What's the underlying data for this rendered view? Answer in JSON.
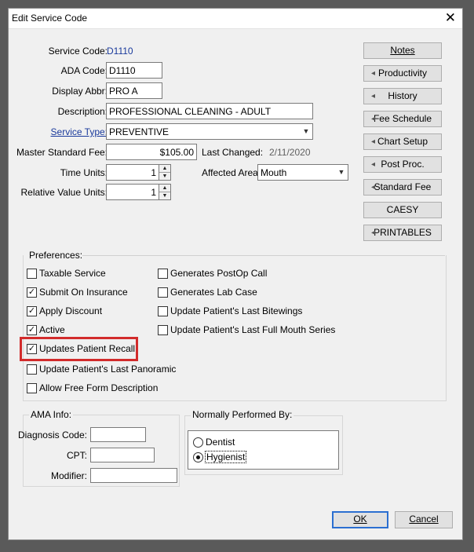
{
  "window": {
    "title": "Edit Service Code",
    "close_glyph": "✕"
  },
  "form": {
    "service_code_label": "Service Code:",
    "service_code_value": "D1110",
    "ada_code_label": "ADA Code:",
    "ada_code_value": "D1110",
    "display_abbr_label": "Display Abbr:",
    "display_abbr_value": "PRO A",
    "description_label": "Description:",
    "description_value": "PROFESSIONAL CLEANING - ADULT",
    "service_type_label": "Service Type:",
    "service_type_value": "PREVENTIVE",
    "master_fee_label": "Master Standard Fee:",
    "master_fee_value": "$105.00",
    "last_changed_label": "Last Changed:",
    "last_changed_value": "2/11/2020",
    "time_units_label": "Time Units:",
    "time_units_value": "1",
    "affected_area_label": "Affected Area:",
    "affected_area_value": "Mouth",
    "rvu_label": "Relative Value Units:",
    "rvu_value": "1"
  },
  "side_buttons": [
    {
      "label": "Notes"
    },
    {
      "label": "Productivity"
    },
    {
      "label": "History"
    },
    {
      "label": "Fee Schedule"
    },
    {
      "label": "Chart Setup"
    },
    {
      "label": "Post Proc."
    },
    {
      "label": "Standard Fee"
    },
    {
      "label": "CAESY"
    },
    {
      "label": "PRINTABLES"
    }
  ],
  "preferences": {
    "label": "Preferences:",
    "items": [
      {
        "label": "Taxable Service",
        "checked": false
      },
      {
        "label": "Submit On Insurance",
        "checked": true
      },
      {
        "label": "Apply Discount",
        "checked": true
      },
      {
        "label": "Active",
        "checked": true
      },
      {
        "label": "Updates Patient Recall",
        "checked": true
      },
      {
        "label": "Update Patient's Last Panoramic",
        "checked": false
      },
      {
        "label": "Allow Free Form Description",
        "checked": false
      },
      {
        "label": "Generates PostOp Call",
        "checked": false
      },
      {
        "label": "Generates Lab Case",
        "checked": false
      },
      {
        "label": "Update Patient's Last Bitewings",
        "checked": false
      },
      {
        "label": "Update Patient's Last Full Mouth Series",
        "checked": false
      }
    ]
  },
  "ama": {
    "label": "AMA Info:",
    "diagnosis_label": "Diagnosis Code:",
    "diagnosis_value": "",
    "cpt_label": "CPT:",
    "cpt_value": "",
    "modifier_label": "Modifier:",
    "modifier_value": ""
  },
  "performed_by": {
    "label": "Normally Performed By:",
    "options": [
      {
        "label": "Dentist",
        "selected": false
      },
      {
        "label": "Hygienist",
        "selected": true
      }
    ]
  },
  "footer": {
    "ok_label": "OK",
    "cancel_label": "Cancel"
  },
  "colors": {
    "highlight": "#d22b2b",
    "link": "#1a3a9c",
    "default_button_border": "#2b6fd1"
  },
  "icons": {
    "spin_up": "▲",
    "spin_down": "▼",
    "dropdown": "▼",
    "button_arrow": "◂",
    "check": "✓"
  }
}
